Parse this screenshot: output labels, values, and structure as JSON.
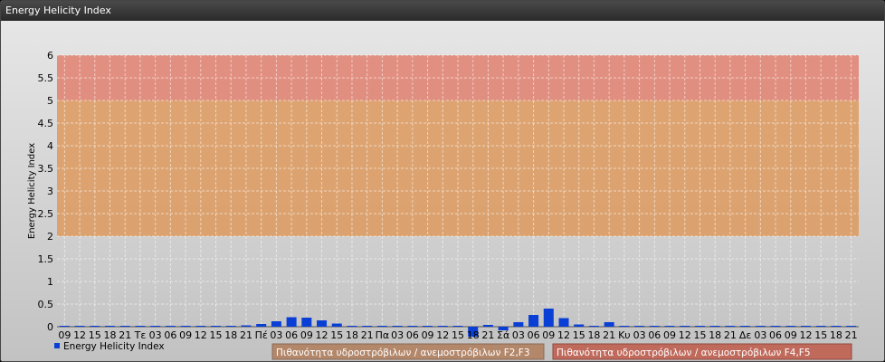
{
  "window": {
    "title": "Energy Helicity Index"
  },
  "chart_data": {
    "type": "bar",
    "ylabel": "Energy Helicity Index",
    "ylim": [
      0,
      6
    ],
    "yticks": [
      "0",
      "0.5",
      "1",
      "1.5",
      "2",
      "2.5",
      "3",
      "3.5",
      "4",
      "4.5",
      "5",
      "5.5",
      "6"
    ],
    "categories": [
      "09",
      "12",
      "15",
      "18",
      "21",
      "Τε",
      "03",
      "06",
      "09",
      "12",
      "15",
      "18",
      "21",
      "Πέ",
      "03",
      "06",
      "09",
      "12",
      "15",
      "18",
      "21",
      "Πα",
      "03",
      "06",
      "09",
      "12",
      "15",
      "18",
      "21",
      "Σά",
      "03",
      "06",
      "09",
      "12",
      "15",
      "18",
      "21",
      "Κυ",
      "03",
      "06",
      "09",
      "12",
      "15",
      "18",
      "21",
      "Δε",
      "03",
      "06",
      "09",
      "12",
      "15",
      "18",
      "21"
    ],
    "bands": [
      {
        "from": 2,
        "to": 5,
        "color": "#dd9a5e"
      },
      {
        "from": 5,
        "to": 6,
        "color": "#e0806e"
      }
    ],
    "series": [
      {
        "name": "Energy Helicity Index",
        "color": "#0a3fd6",
        "values": [
          0.02,
          0.02,
          0.02,
          0.02,
          0.02,
          0.02,
          0.02,
          0.02,
          0.02,
          0.02,
          0.02,
          0.02,
          0.03,
          0.06,
          0.12,
          0.21,
          0.2,
          0.14,
          0.07,
          0.02,
          0.02,
          0.02,
          0.02,
          0.02,
          0.02,
          0.02,
          0.02,
          -0.22,
          0.04,
          -0.08,
          0.1,
          0.26,
          0.4,
          0.19,
          0.05,
          0.02,
          0.1,
          0.02,
          0.02,
          0.02,
          0.02,
          0.02,
          0.02,
          0.02,
          0.02,
          0.02,
          0.02,
          0.02,
          0.02,
          0.02,
          0.02,
          0.02,
          0.02
        ]
      }
    ],
    "legend": {
      "placement": "bottom",
      "entries": [
        {
          "label": "Energy Helicity Index",
          "color": "#0a3fd6"
        },
        {
          "label": "Πιθανότητα υδροστρόβιλων / ανεμοστρόβιλων F2,F3",
          "color": "#b3876a"
        },
        {
          "label": "Πιθανότητα υδροστρόβιλων / ανεμοστρόβιλων F4,F5",
          "color": "#c06a5c"
        }
      ]
    },
    "grid": true
  }
}
